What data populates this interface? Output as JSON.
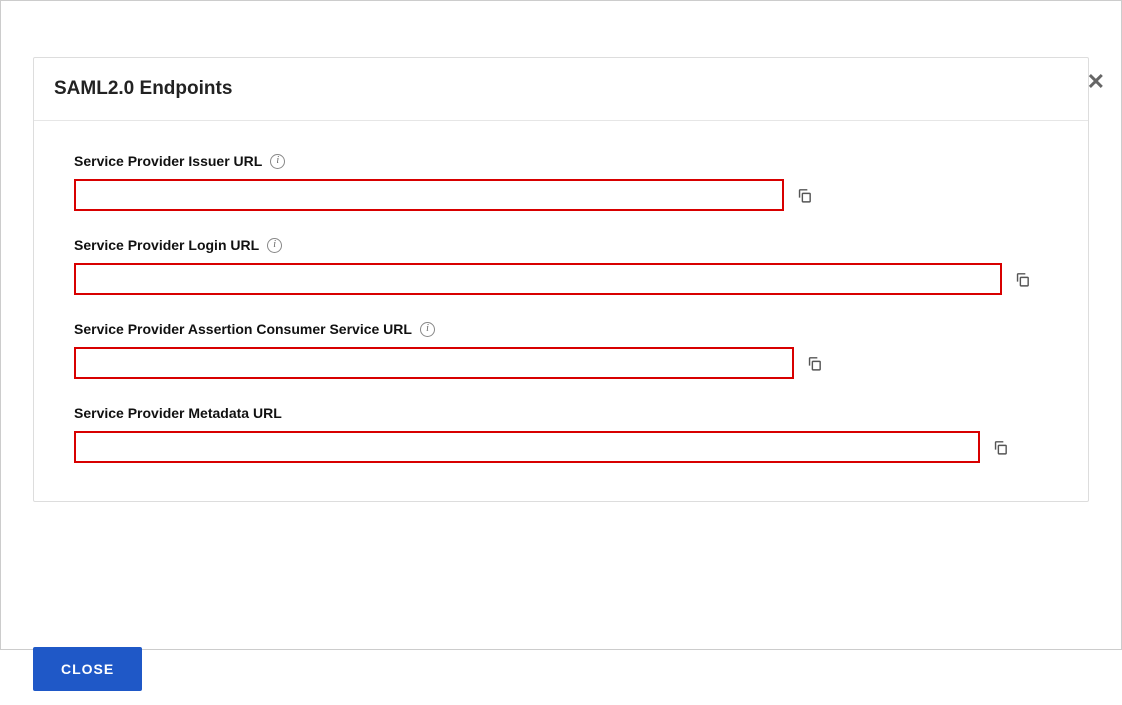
{
  "dialog": {
    "close_x": "✕"
  },
  "card": {
    "title": "SAML2.0 Endpoints"
  },
  "fields": {
    "issuer": {
      "label": "Service Provider Issuer URL",
      "value": "",
      "has_info": true
    },
    "login": {
      "label": "Service Provider Login URL",
      "value": "",
      "has_info": true
    },
    "acs": {
      "label": "Service Provider Assertion Consumer Service URL",
      "value": "",
      "has_info": true
    },
    "metadata": {
      "label": "Service Provider Metadata URL",
      "value": "",
      "has_info": false
    }
  },
  "icons": {
    "info_glyph": "i"
  },
  "footer": {
    "close_label": "CLOSE"
  },
  "colors": {
    "highlight_border": "#d80000",
    "primary_button": "#1f58c7"
  }
}
